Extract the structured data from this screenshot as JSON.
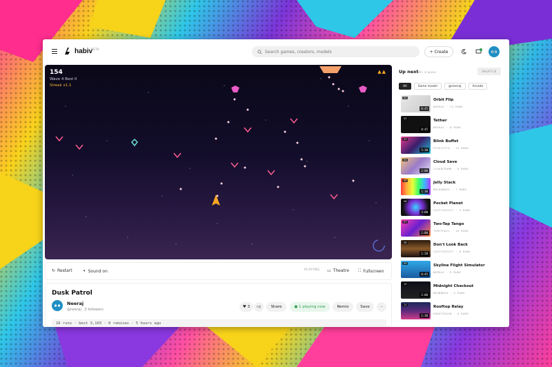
{
  "header": {
    "brand": "habiv",
    "beta": "BETA",
    "search_placeholder": "Search games, creators, models",
    "create_label": "+ Create"
  },
  "game": {
    "score": "154",
    "wave": "Wave 4   Best 0",
    "streak": "Streak x1.1",
    "lives": "▲▲"
  },
  "controls": {
    "restart": "Restart",
    "sound": "Sound on",
    "status": "PLAYING",
    "theatre": "Theatre",
    "fullscreen": "Fullscreen"
  },
  "info": {
    "title": "Dusk Patrol",
    "user_name": "Neeraj",
    "user_handle": "@neeraj · 0 followers",
    "likes": "♥ 3",
    "share": "Share",
    "playing": "● 1 playing now",
    "remix": "Remix",
    "save": "Save",
    "more": "–",
    "stats": "16 runs · best 3,103 · 0 remixes · 5 hours ago"
  },
  "sidebar": {
    "title": "Up next",
    "subtitle": "36+ in queue",
    "shuffle": "SHUFFLE",
    "tabs": [
      "All",
      "Same model",
      "@neeraj",
      "Arcade"
    ],
    "items": [
      {
        "num": "01",
        "name": "Orbit Flip",
        "meta": "NEERAJ · 13 RUNS",
        "dur": "0:45"
      },
      {
        "num": "02",
        "name": "Tether",
        "meta": "NEERAJ · 8 RUNS",
        "dur": "0:45"
      },
      {
        "num": "03",
        "name": "Blink Buffet",
        "meta": "PIXELPITA · 14 RUNS",
        "dur": "5:30"
      },
      {
        "num": "04",
        "name": "Cloud Save",
        "meta": "CLOUDCRUMB · 6 RUNS",
        "dur": "2:00"
      },
      {
        "num": "05",
        "name": "Jelly Stack",
        "meta": "MOCHAMOSS · 7 RUNS",
        "dur": "1:30"
      },
      {
        "num": "06",
        "name": "Pocket Planet",
        "meta": "COZYCIRCUIT · 9 RUNS",
        "dur": "3:00"
      },
      {
        "num": "07",
        "name": "Two-Tap Tango",
        "meta": "TINYTRAIL · 10 RUNS",
        "dur": "1:00"
      },
      {
        "num": "08",
        "name": "Don't Look Back",
        "meta": "COZYCIRCUIT · 8 RUNS",
        "dur": "1:20"
      },
      {
        "num": "09",
        "name": "Skyline Flight Simulator",
        "meta": "NEERAJ · 9 RUNS",
        "dur": "0:45"
      },
      {
        "num": "10",
        "name": "Midnight Checkout",
        "meta": "NEONNOVA · 4 RUNS",
        "dur": "2:00"
      },
      {
        "num": "11",
        "name": "Rooftop Relay",
        "meta": "GHOSTGRAIN · 6 RUNS",
        "dur": "1:30"
      }
    ]
  },
  "colors": {
    "accent_green": "#2e9e4f",
    "enemy_pink": "#ff5d8f",
    "player": "#f5a623"
  }
}
